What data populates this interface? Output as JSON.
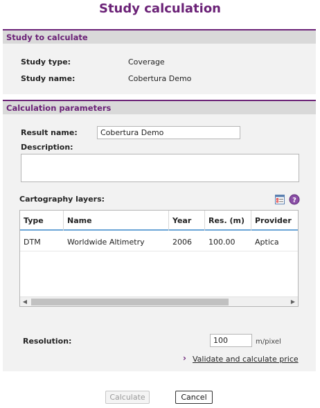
{
  "page": {
    "title": "Study calculation"
  },
  "study_section": {
    "header": "Study to calculate",
    "type_label": "Study type:",
    "type_value": "Coverage",
    "name_label": "Study name:",
    "name_value": "Cobertura Demo"
  },
  "params_section": {
    "header": "Calculation parameters",
    "result_name_label": "Result name:",
    "result_name_value": "Cobertura Demo",
    "description_label": "Description:",
    "description_value": "",
    "layers_label": "Cartography layers:",
    "layers_table": {
      "columns": [
        "Type",
        "Name",
        "Year",
        "Res. (m)",
        "Provider"
      ],
      "rows": [
        {
          "type": "DTM",
          "name": "Worldwide Altimetry",
          "year": "2006",
          "res": "100.00",
          "provider": "Aptica"
        }
      ]
    },
    "resolution_label": "Resolution:",
    "resolution_value": "100",
    "resolution_unit": "m/pixel",
    "validate_link": "Validate and calculate price"
  },
  "buttons": {
    "calculate": "Calculate",
    "cancel": "Cancel"
  },
  "icons": {
    "layers_select": "layer-list-icon",
    "help": "help-icon",
    "link_chevron": "chevron-right-icon"
  },
  "colors": {
    "accent": "#6b2277",
    "header_bg": "#d9d9d9",
    "section_bg": "#f2f2f2",
    "table_header_line": "#6aa4d6"
  }
}
